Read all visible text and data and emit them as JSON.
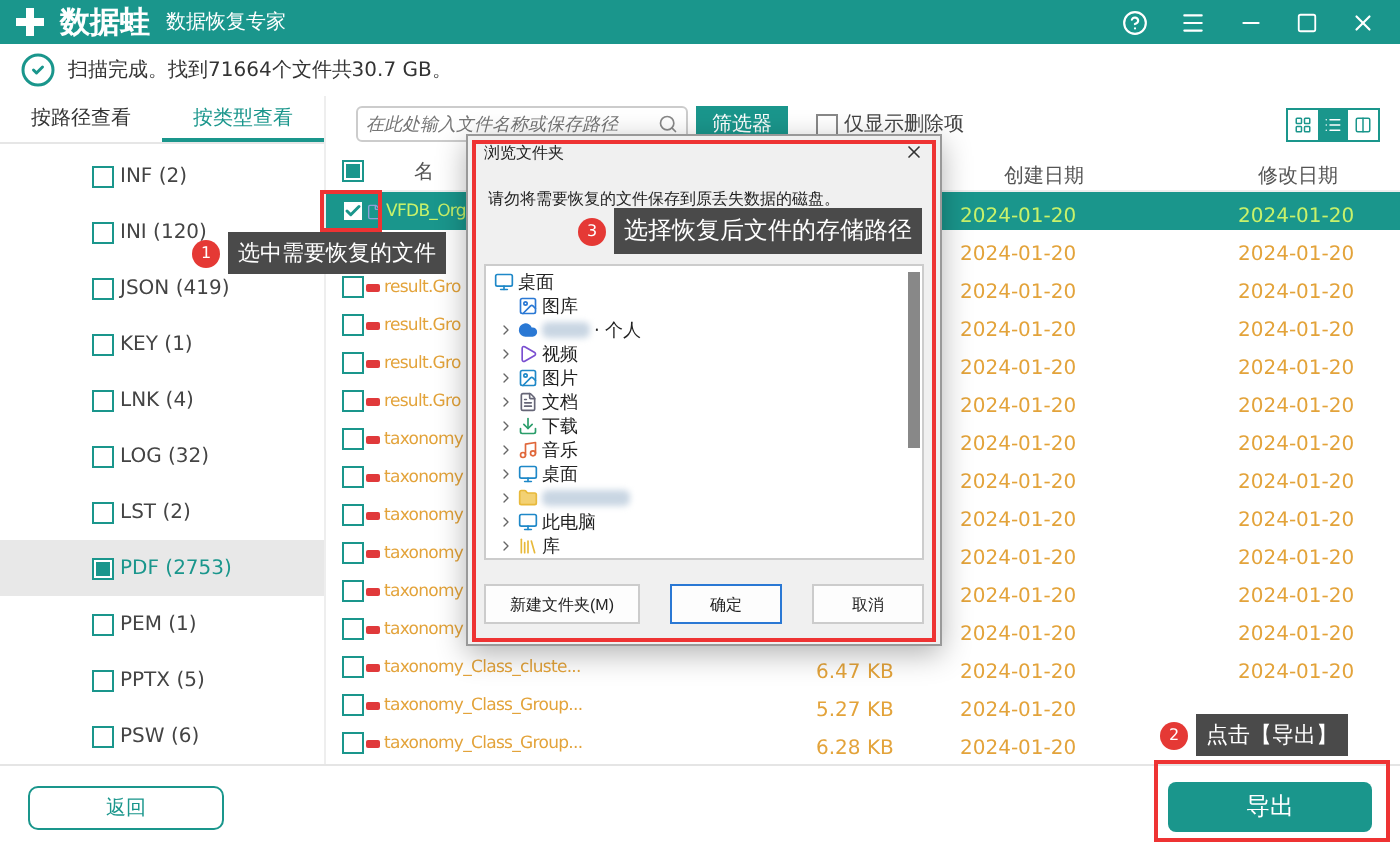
{
  "app": {
    "logo": "数据蛙",
    "subtitle": "数据恢复专家"
  },
  "scan_status": "扫描完成。找到71664个文件共30.7 GB。",
  "view_tabs": [
    {
      "label": "按路径查看",
      "selected": false
    },
    {
      "label": "按类型查看",
      "selected": true
    }
  ],
  "file_types": [
    {
      "label": "INF (2)",
      "checked": false,
      "selected": false
    },
    {
      "label": "INI (120)",
      "checked": false,
      "selected": false
    },
    {
      "label": "JSON (419)",
      "checked": false,
      "selected": false
    },
    {
      "label": "KEY (1)",
      "checked": false,
      "selected": false
    },
    {
      "label": "LNK (4)",
      "checked": false,
      "selected": false
    },
    {
      "label": "LOG (32)",
      "checked": false,
      "selected": false
    },
    {
      "label": "LST (2)",
      "checked": false,
      "selected": false
    },
    {
      "label": "PDF (2753)",
      "checked": true,
      "selected": true
    },
    {
      "label": "PEM (1)",
      "checked": false,
      "selected": false
    },
    {
      "label": "PPTX (5)",
      "checked": false,
      "selected": false
    },
    {
      "label": "PSW (6)",
      "checked": false,
      "selected": false
    }
  ],
  "search": {
    "placeholder": "在此处输入文件名称或保存路径"
  },
  "filter_button": "筛选器",
  "deleted_only": {
    "label": "仅显示删除项",
    "checked": false
  },
  "view_modes": [
    {
      "kind": "grid",
      "selected": false
    },
    {
      "kind": "list",
      "selected": true
    },
    {
      "kind": "detail",
      "selected": false
    }
  ],
  "table": {
    "partially_checked": true,
    "columns": [
      "名",
      "创建日期",
      "修改日期"
    ],
    "rows": [
      {
        "kind": "file",
        "name": "VFDB_Org",
        "created": "2024-01-20",
        "modified": "2024-01-20",
        "checked": true,
        "selected": true
      },
      {
        "kind": "deleted",
        "created": "2024-01-20",
        "modified": "2024-01-20",
        "selected": false
      },
      {
        "kind": "deleted",
        "name": "result.Gro",
        "created": "2024-01-20",
        "modified": "2024-01-20",
        "checked": false,
        "selected": false
      },
      {
        "kind": "deleted",
        "name": "result.Gro",
        "created": "2024-01-20",
        "modified": "2024-01-20",
        "checked": false,
        "selected": false
      },
      {
        "kind": "deleted",
        "name": "result.Gro",
        "created": "2024-01-20",
        "modified": "2024-01-20",
        "checked": false,
        "selected": false
      },
      {
        "kind": "deleted",
        "name": "result.Gro",
        "created": "2024-01-20",
        "modified": "2024-01-20",
        "checked": false,
        "selected": false
      },
      {
        "kind": "deleted",
        "name": "taxonomy",
        "created": "2024-01-20",
        "modified": "2024-01-20",
        "checked": false,
        "selected": false
      },
      {
        "kind": "deleted",
        "name": "taxonomy",
        "created": "2024-01-20",
        "modified": "2024-01-20",
        "checked": false,
        "selected": false
      },
      {
        "kind": "deleted",
        "name": "taxonomy",
        "created": "2024-01-20",
        "modified": "2024-01-20",
        "checked": false,
        "selected": false
      },
      {
        "kind": "deleted",
        "name": "taxonomy",
        "created": "2024-01-20",
        "modified": "2024-01-20",
        "checked": false,
        "selected": false
      },
      {
        "kind": "deleted",
        "name": "taxonomy",
        "created": "2024-01-20",
        "modified": "2024-01-20",
        "checked": false,
        "selected": false
      },
      {
        "kind": "deleted",
        "name": "taxonomy",
        "created": "2024-01-20",
        "modified": "2024-01-20",
        "checked": false,
        "selected": false
      },
      {
        "kind": "deleted",
        "name": "taxonomy_Class_cluste...",
        "size": "6.47 KB",
        "created": "2024-01-20",
        "modified": "2024-01-20",
        "checked": false,
        "selected": false
      },
      {
        "kind": "deleted",
        "name": "taxonomy_Class_Group...",
        "size": "5.27 KB",
        "created": "2024-01-20",
        "checked": false,
        "selected": false
      },
      {
        "kind": "deleted",
        "name": "taxonomy_Class_Group...",
        "size": "6.28 KB",
        "created": "2024-01-20",
        "checked": false,
        "selected": false
      }
    ]
  },
  "dialog": {
    "title": "浏览文件夹",
    "message": "请勿将需要恢复的文件保存到原丢失数据的磁盘。",
    "tree": [
      {
        "kind": "desktop",
        "label": "桌面",
        "children": [
          {
            "kind": "gallery",
            "label": "图库",
            "expandable": false
          },
          {
            "kind": "cloud",
            "label": "· 个人",
            "redacted": true,
            "expandable": true
          },
          {
            "kind": "video",
            "label": "视频",
            "expandable": true
          },
          {
            "kind": "pictures",
            "label": "图片",
            "expandable": true
          },
          {
            "kind": "documents",
            "label": "文档",
            "expandable": true
          },
          {
            "kind": "downloads",
            "label": "下载",
            "expandable": true
          },
          {
            "kind": "music",
            "label": "音乐",
            "expandable": true
          },
          {
            "kind": "desktop",
            "label": "桌面",
            "expandable": true
          },
          {
            "kind": "folder",
            "redacted": true,
            "expandable": true
          },
          {
            "kind": "computer",
            "label": "此电脑",
            "expandable": true
          },
          {
            "kind": "library",
            "label": "库",
            "expandable": true
          }
        ]
      }
    ],
    "buttons": [
      {
        "label": "新建文件夹(M)",
        "default": false
      },
      {
        "label": "确定",
        "default": true
      },
      {
        "label": "取消",
        "default": false
      }
    ]
  },
  "annotations": [
    {
      "number": "1",
      "text": "选中需要恢复的文件"
    },
    {
      "number": "3",
      "text": "选择恢复后文件的存储路径"
    },
    {
      "number": "2",
      "text": "点击【导出】"
    }
  ],
  "back_button": "返回",
  "export_button": "导出"
}
